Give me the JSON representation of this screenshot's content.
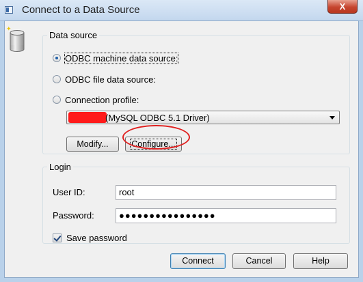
{
  "window": {
    "title": "Connect to a Data Source",
    "close_symbol": "X"
  },
  "data_source": {
    "legend": "Data source",
    "options": [
      {
        "label": "ODBC machine data source:",
        "checked": true
      },
      {
        "label": "ODBC file data source:",
        "checked": false
      },
      {
        "label": "Connection profile:",
        "checked": false
      }
    ],
    "selected_source": "(MySQL ODBC 5.1 Driver)",
    "modify_label": "Modify...",
    "configure_label": "Configure..."
  },
  "login": {
    "legend": "Login",
    "user_id_label": "User ID:",
    "user_id_value": "root",
    "password_label": "Password:",
    "password_masked": "●●●●●●●●●●●●●●●●",
    "save_password_label": "Save password",
    "save_password_checked": true
  },
  "footer": {
    "connect_label": "Connect",
    "cancel_label": "Cancel",
    "help_label": "Help"
  },
  "colors": {
    "annotation_ellipse": "#e0201f",
    "redaction": "#ff1a1a",
    "close_button": "#c6452f"
  },
  "icons": [
    "app-icon",
    "close-icon",
    "database-icon",
    "dropdown-arrow-icon"
  ]
}
